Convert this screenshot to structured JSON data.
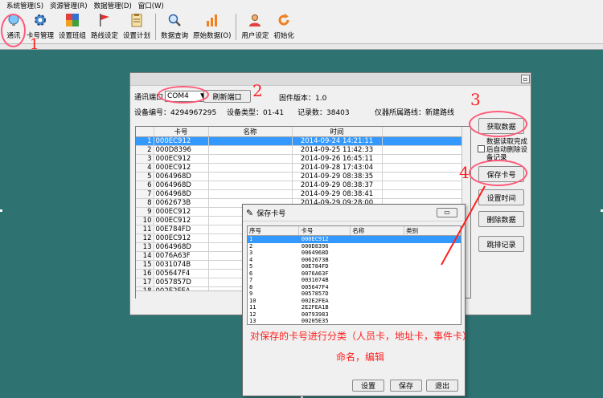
{
  "menu": [
    "系统管理(S)",
    "资源管理(R)",
    "数据管理(D)",
    "窗口(W)"
  ],
  "toolbar": {
    "group1": [
      {
        "label": "通讯",
        "icon": "lightbulb-icon"
      },
      {
        "label": "卡号管理",
        "icon": "gear-icon"
      },
      {
        "label": "设置班组",
        "icon": "grid-palette-icon"
      },
      {
        "label": "路线设定",
        "icon": "flag-icon"
      },
      {
        "label": "设置计划",
        "icon": "clipboard-icon"
      }
    ],
    "group2": [
      {
        "label": "数据查询",
        "icon": "magnifier-icon"
      },
      {
        "label": "原始数据(O)",
        "icon": "bar-chart-icon"
      }
    ],
    "group3": [
      {
        "label": "用户设定",
        "icon": "users-icon"
      },
      {
        "label": "初始化",
        "icon": "refresh-icon"
      }
    ]
  },
  "comm": {
    "port_label": "通讯端口",
    "port_value": "COM4",
    "refresh_label": "刷新端口",
    "firmware_label": "固件版本：1.0",
    "device_id_label": "设备编号：4294967295",
    "device_type_label": "设备类型：01-41",
    "record_count_label": "记录数：38403",
    "route_label": "仪器所属路线：新建路线",
    "columns": [
      "卡号",
      "名称",
      "时间"
    ],
    "rows": [
      {
        "n": "1",
        "card": "000EC912",
        "time": "2014-09-24 14:21:11"
      },
      {
        "n": "2",
        "card": "000D8396",
        "time": "2014-09-25 11:42:33"
      },
      {
        "n": "3",
        "card": "000EC912",
        "time": "2014-09-26 16:45:11"
      },
      {
        "n": "4",
        "card": "000EC912",
        "time": "2014-09-28 17:43:04"
      },
      {
        "n": "5",
        "card": "0064968D",
        "time": "2014-09-29 08:38:35"
      },
      {
        "n": "6",
        "card": "0064968D",
        "time": "2014-09-29 08:38:37"
      },
      {
        "n": "7",
        "card": "0064968D",
        "time": "2014-09-29 08:38:41"
      },
      {
        "n": "8",
        "card": "0062673B",
        "time": "2014-09-29 09:28:00"
      },
      {
        "n": "9",
        "card": "000EC912",
        "time": ""
      },
      {
        "n": "10",
        "card": "000EC912",
        "time": ""
      },
      {
        "n": "11",
        "card": "00E784FD",
        "time": ""
      },
      {
        "n": "12",
        "card": "000EC912",
        "time": ""
      },
      {
        "n": "13",
        "card": "0064968D",
        "time": ""
      },
      {
        "n": "14",
        "card": "0076A63F",
        "time": ""
      },
      {
        "n": "15",
        "card": "0031074B",
        "time": ""
      },
      {
        "n": "16",
        "card": "005647F4",
        "time": ""
      },
      {
        "n": "17",
        "card": "0057857D",
        "time": ""
      },
      {
        "n": "18",
        "card": "002E2FEA",
        "time": ""
      }
    ],
    "get_data": "获取数据",
    "auto_delete": "数据读取完成后自动删除设备记录",
    "save_card": "保存卡号",
    "set_time": "设置时间",
    "delete_data": "删除数据",
    "jump_record": "跳排记录"
  },
  "save_dialog": {
    "title": "保存卡号",
    "columns": [
      "序号",
      "卡号",
      "名称",
      "类别"
    ],
    "rows": [
      {
        "n": "1",
        "card": "000EC912"
      },
      {
        "n": "2",
        "card": "000D8396"
      },
      {
        "n": "3",
        "card": "0064968D"
      },
      {
        "n": "4",
        "card": "0062673B"
      },
      {
        "n": "5",
        "card": "00E784FD"
      },
      {
        "n": "6",
        "card": "0076A63F"
      },
      {
        "n": "7",
        "card": "0031074B"
      },
      {
        "n": "8",
        "card": "005647F4"
      },
      {
        "n": "9",
        "card": "0057857D"
      },
      {
        "n": "10",
        "card": "002E2FEA"
      },
      {
        "n": "11",
        "card": "2E2FEA1B"
      },
      {
        "n": "12",
        "card": "00793983"
      },
      {
        "n": "13",
        "card": "00205E35"
      }
    ],
    "set_btn": "设置",
    "save_btn": "保存",
    "exit_btn": "退出"
  },
  "annotations": {
    "n1": "1",
    "n2": "2",
    "n3": "3",
    "n4": "4",
    "note_line1": "对保存的卡号进行分类（人员卡，地址卡，事件卡）",
    "note_line2": "命名，编辑",
    "color": "#ff2020"
  },
  "colors": {
    "desktop": "#2f7272",
    "selection": "#3399ff"
  }
}
